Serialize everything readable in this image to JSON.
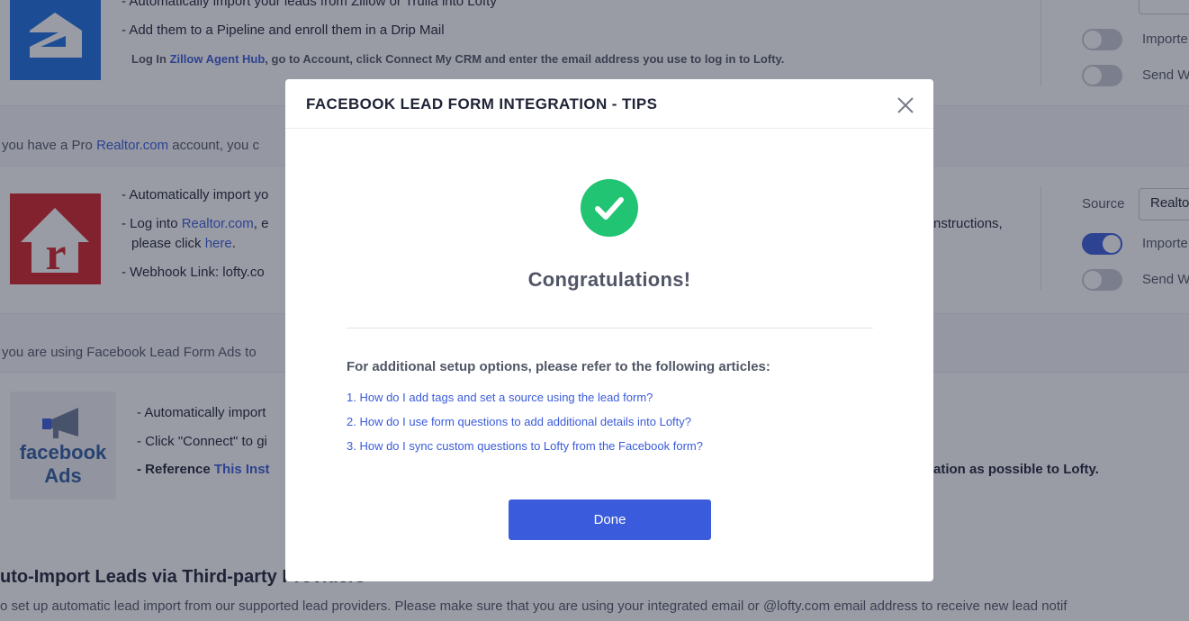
{
  "background": {
    "zillow": {
      "line_top": "- Automatically import your leads from Zillow or Trulia into Lofty",
      "line_pipeline": "- Add them to a Pipeline and enroll them in a Drip Mail",
      "instr_prefix": "Log In ",
      "instr_link": "Zillow Agent Hub",
      "instr_suffix": ", go to Account, click Connect My CRM and enter the email address you use to log in to Lofty.",
      "toggle1_label": "Importe",
      "toggle2_label": "Send W"
    },
    "realtor": {
      "note_prefix": "you have a Pro ",
      "note_link": "Realtor.com",
      "note_suffix": " account, you c",
      "line1": "- Automatically import yo",
      "line2_prefix": "- Log into ",
      "line2_link": "Realtor.com",
      "line2_suffix": ", e",
      "line2_right": "nstructions,",
      "line3_prefix": "please click ",
      "line3_link": "here",
      "line3_suffix": ".",
      "line4": "- Webhook Link: lofty.co",
      "source_label": "Source",
      "source_value": "Realto",
      "toggle1_label": "Importe",
      "toggle2_label": "Send W"
    },
    "facebook": {
      "note": "you are using Facebook Lead Form Ads to",
      "line1": "- Automatically import",
      "line2": "- Click \"Connect\" to gi",
      "line3_prefix": "- Reference ",
      "line3_link": "This Inst",
      "line3_right": "ation as possible to Lofty.",
      "logo_line1": "facebook",
      "logo_line2": "Ads"
    },
    "third_party": {
      "title": "uto-Import Leads via Third-party Providers",
      "desc": "o set up automatic lead import from our supported lead providers. Please make sure that you are using your integrated email or @lofty.com email address to receive new lead notif"
    }
  },
  "modal": {
    "title": "FACEBOOK LEAD FORM INTEGRATION - TIPS",
    "heading": "Congratulations!",
    "intro": "For additional setup options, please refer to the following articles:",
    "articles": [
      "1. How do I add tags and set a source using the lead form?",
      "2. How do I use form questions to add additional details into Lofty?",
      "3. How do I sync custom questions to Lofty from the Facebook form?"
    ],
    "done_label": "Done"
  },
  "colors": {
    "accent": "#3a5bdb",
    "success": "#20c472",
    "zillow_blue": "#1a6fe0",
    "realtor_red": "#d52228",
    "facebook_blue": "#2f5ea0"
  },
  "icons": [
    "zillow-logo",
    "realtor-logo",
    "facebook-ads-logo",
    "close-icon",
    "check-icon"
  ]
}
